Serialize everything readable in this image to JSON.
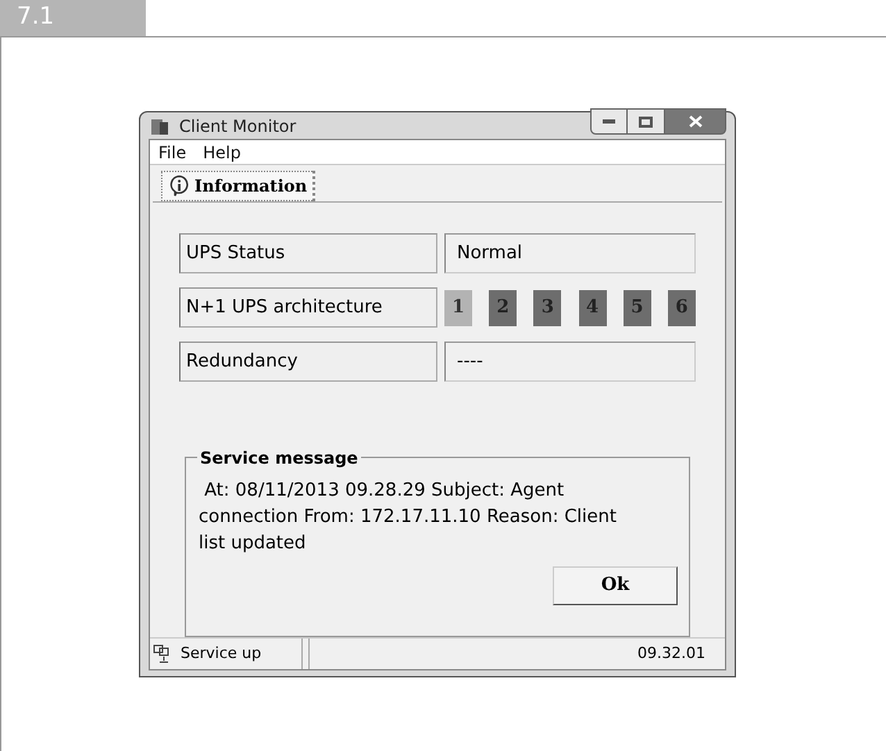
{
  "section": "7.1",
  "window": {
    "title": "Client Monitor"
  },
  "menu": [
    "File",
    "Help"
  ],
  "tabs": [
    {
      "label": "Information",
      "selected": true
    }
  ],
  "fields": [
    {
      "label": "UPS Status",
      "kind": "text",
      "value": "Normal"
    },
    {
      "label": "N+1 UPS architecture",
      "kind": "units",
      "units": [
        {
          "label": "1",
          "lit": true
        },
        {
          "label": "2",
          "lit": false
        },
        {
          "label": "3",
          "lit": false
        },
        {
          "label": "4",
          "lit": false
        },
        {
          "label": "5",
          "lit": false
        },
        {
          "label": "6",
          "lit": false
        }
      ]
    },
    {
      "label": "Redundancy",
      "kind": "text",
      "value": "----"
    }
  ],
  "service_message": {
    "title": "Service message",
    "text": " At: 08/11/2013 09.28.29 Subject: Agent connection From: 172.17.11.10 Reason: Client list updated",
    "button": "Ok"
  },
  "status_bar": {
    "status": "Service up",
    "time": "09.32.01"
  }
}
